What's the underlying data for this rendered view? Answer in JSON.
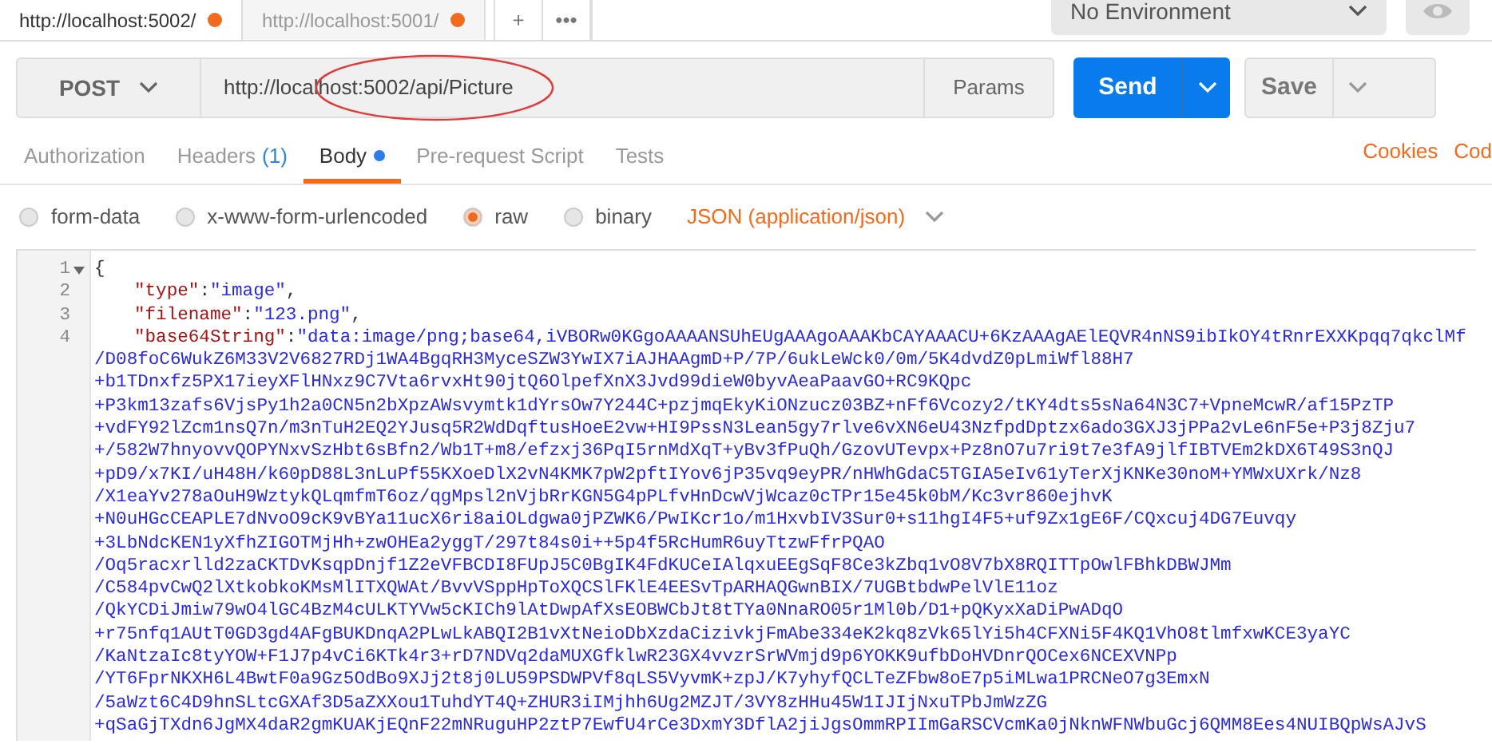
{
  "request_tabs": [
    {
      "label": "http://localhost:5002/",
      "selected": true,
      "unsaved": true
    },
    {
      "label": "http://localhost:5001/",
      "selected": false,
      "unsaved": true
    }
  ],
  "tab_actions": [
    "+",
    "•••"
  ],
  "environment": {
    "value": "No Environment"
  },
  "method": "POST",
  "url": "http://localhost:5002/api/Picture",
  "url_annotation": true,
  "buttons": {
    "params": "Params",
    "send": "Send",
    "save": "Save"
  },
  "sub_tabs": [
    {
      "label": "Authorization",
      "selected": false,
      "has_content": false
    },
    {
      "label": "Headers",
      "count": "(1)",
      "selected": false,
      "has_content": false
    },
    {
      "label": "Body",
      "selected": true,
      "has_content": true
    },
    {
      "label": "Pre-request Script",
      "selected": false,
      "has_content": false
    },
    {
      "label": "Tests",
      "selected": false,
      "has_content": false
    }
  ],
  "links": [
    "Cookies",
    "Cod"
  ],
  "body_modes": [
    {
      "label": "form-data",
      "selected": false
    },
    {
      "label": "x-www-form-urlencoded",
      "selected": false
    },
    {
      "label": "raw",
      "selected": true
    },
    {
      "label": "binary",
      "selected": false
    }
  ],
  "content_type": "JSON (application/json)",
  "editor": {
    "lines": [
      {
        "number": "1",
        "kind": "brace",
        "foldable": true,
        "text": "{"
      },
      {
        "number": "2",
        "kind": "pair",
        "foldable": false,
        "key": "\"type\"",
        "colon": ":",
        "value": "\"image\"",
        "punct": ","
      },
      {
        "number": "3",
        "kind": "pair",
        "foldable": false,
        "key": "\"filename\"",
        "colon": ":",
        "value": "\"123.png\"",
        "punct": ","
      },
      {
        "number": "4",
        "kind": "pair",
        "foldable": false,
        "key": "\"base64String\"",
        "colon": ":",
        "value": "\"data:image/png;base64,iVBORw0KGgoAAAANSUhEUgAAAgoAAAKbCAYAAACU+6KzAAAgAElEQVR4nNS9ibIkOY4tRnrEXXKpqq7qkclMf",
        "wrap": [
          "/D08foC6WukZ6M33V2V6827RDj1WA4BgqRH3MyceSZW3YwIX7iAJHAAgmD+P/7P/6ukLeWck0/0m/5K4dvdZ0pLmiWfl88H7",
          "+b1TDnxfz5PX17ieyXFlHNxz9C7Vta6rvxHt90jtQ6OlpefXnX3Jvd99dieW0byvAeaPaavGO+RC9KQpc",
          "+P3km13zafs6VjsPy1h2a0CN5n2bXpzAWsvymtk1dYrsOw7Y244C+pzjmqEkyKiONzucz03BZ+nFf6Vcozy2/tKY4dts5sNa64N3C7+VpneMcwR/af15PzTP",
          "+vdFY92lZcm1nsQ7n/m3nTuH2EQ2YJusq5R2WdDqftusHoeE2vw+HI9PssN3Lean5gy7rlve6vXN6eU43NzfpdDptzx6ado3GXJ3jPPa2vLe6nF5e+P3j8Zju7",
          "+/582W7hnyovvQOPYNxvSzHbt6sBfn2/Wb1T+m8/efzxj36PqI5rnMdXqT+yBv3fPuQh/GzovUTevpx+Pz8nO7u7ri9t7e3fA9jlfIBTVEm2kDX6T49S3nQJ",
          "+pD9/x7KI/uH48H/k60pD88L3nLuPf55KXoeDlX2vN4KMK7pW2pftIYov6jP35vq9eyPR/nHWhGdaC5TGIA5eIv61yTerXjKNKe30noM+YMWxUXrk/Nz8",
          "/X1eaYv278aOuH9WztykQLqmfmT6oz/qgMpsl2nVjbRrKGN5G4pPLfvHnDcwVjWcaz0cTPr15e45k0bM/Kc3vr860ejhvK",
          "+N0uHGcCEAPLE7dNvoO9cK9vBYa11ucX6ri8aiOLdgwa0jPZWK6/PwIKcr1o/m1HxvbIV3Sur0+s11hgI4F5+uf9Zx1gE6F/CQxcuj4DG7Euvqy",
          "+3LbNdcKEN1yXfhZIGOTMjHh+zwOHEa2yggT/297t84s0i++5p4f5RcHumR6uyTtzwFfrPQAO",
          "/Oq5racxrlld2zaCKTDvKsqpDnjf1Z2eVFBCDI8FUpJ5C0BgIK4FdKUCeIAlqxuEEgSqF8Ce3kZbq1vO8V7bX8RQITTpOwlFBhkDBWJMm",
          "/C584pvCwQ2lXtkobkoKMsMlITXQWAt/BvvVSppHpToXQCSlFKlE4EESvTpARHAQGwnBIX/7UGBtbdwPelVlE11oz",
          "/QkYCDiJmiw79wO4lGC4BzM4cULKTYVw5cKICh9lAtDwpAfXsEOBWCbJt8tTYa0NnaRO05r1Ml0b/D1+pQKyxXaDiPwADqO",
          "+r75nfq1AUtT0GD3gd4AFgBUKDnqA2PLwLkABQI2B1vXtNeioDbXzdaCizivkjFmAbe334eK2kq8zVk65lYi5h4CFXNi5F4KQ1VhO8tlmfxwKCE3yaYC",
          "/KaNtzaIc8tyYOW+F1J7p4vCi6KTk4r3+rD7NDVq2daMUXGfklwR23GX4vvzrSrWVmjd9p6YOKK9ufbDoHVDnrQOCex6NCEXVNPp",
          "/YT6FprNKXH6L4BwtF0a9Gz5OdBo9XJj2t8j0LU59PSDWPVf8qLS5VyvmK+zpJ/K7yhyfQCLTeZFbw8oE7p5iMLwa1PRCNeO7g3EmxN",
          "/5aWzt6C4D9hnSLtcGXAf3D5aZXXou1TuhdYT4Q+ZHUR3iIMjhh6Ug2MZJT/3VY8zHHu45W1IJIjNxuTPbJmWzZG",
          "+qSaGjTXdn6JgMX4daR2gmKUAKjEQnF22mNRuguHP2ztP7EwfU4rCe3DxmY3DflA2jiJgsOmmRPIImGaRSCVcmKa0jNknWFNWbuGcj6QMM8Ees4NUIBQpWsAJvS"
        ]
      }
    ]
  }
}
